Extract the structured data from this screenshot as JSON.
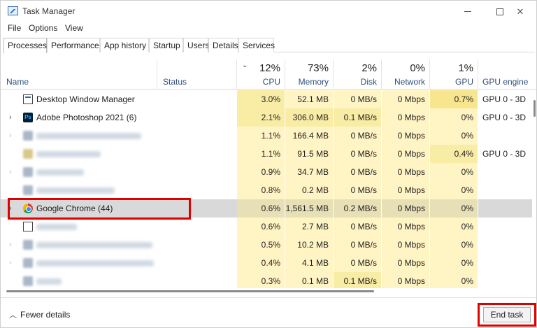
{
  "window": {
    "title": "Task Manager"
  },
  "menu": [
    "File",
    "Options",
    "View"
  ],
  "tabs": [
    "Processes",
    "Performance",
    "App history",
    "Startup",
    "Users",
    "Details",
    "Services"
  ],
  "columns": {
    "name": "Name",
    "status": "Status",
    "cpu": {
      "pct": "12%",
      "label": "CPU"
    },
    "memory": {
      "pct": "73%",
      "label": "Memory"
    },
    "disk": {
      "pct": "2%",
      "label": "Disk"
    },
    "network": {
      "pct": "0%",
      "label": "Network"
    },
    "gpu": {
      "pct": "1%",
      "label": "GPU"
    },
    "gpu_engine": "GPU engine"
  },
  "rows": [
    {
      "name": "Desktop Window Manager",
      "cpu": "3.0%",
      "memory": "52.1 MB",
      "disk": "0 MB/s",
      "network": "0 Mbps",
      "gpu": "0.7%",
      "gpu_engine": "GPU 0 - 3D"
    },
    {
      "name": "Adobe Photoshop 2021 (6)",
      "cpu": "2.1%",
      "memory": "306.0 MB",
      "disk": "0.1 MB/s",
      "network": "0 Mbps",
      "gpu": "0%",
      "gpu_engine": "GPU 0 - 3D"
    },
    {
      "name": "",
      "cpu": "1.1%",
      "memory": "166.4 MB",
      "disk": "0 MB/s",
      "network": "0 Mbps",
      "gpu": "0%",
      "gpu_engine": ""
    },
    {
      "name": "",
      "cpu": "1.1%",
      "memory": "91.5 MB",
      "disk": "0 MB/s",
      "network": "0 Mbps",
      "gpu": "0.4%",
      "gpu_engine": "GPU 0 - 3D"
    },
    {
      "name": "",
      "cpu": "0.9%",
      "memory": "34.7 MB",
      "disk": "0 MB/s",
      "network": "0 Mbps",
      "gpu": "0%",
      "gpu_engine": ""
    },
    {
      "name": "",
      "cpu": "0.8%",
      "memory": "0.2 MB",
      "disk": "0 MB/s",
      "network": "0 Mbps",
      "gpu": "0%",
      "gpu_engine": ""
    },
    {
      "name": "Google Chrome (44)",
      "cpu": "0.6%",
      "memory": "1,561.5 MB",
      "disk": "0.2 MB/s",
      "network": "0 Mbps",
      "gpu": "0%",
      "gpu_engine": ""
    },
    {
      "name": "",
      "cpu": "0.6%",
      "memory": "2.7 MB",
      "disk": "0 MB/s",
      "network": "0 Mbps",
      "gpu": "0%",
      "gpu_engine": ""
    },
    {
      "name": "",
      "cpu": "0.5%",
      "memory": "10.2 MB",
      "disk": "0 MB/s",
      "network": "0 Mbps",
      "gpu": "0%",
      "gpu_engine": ""
    },
    {
      "name": "",
      "cpu": "0.4%",
      "memory": "4.1 MB",
      "disk": "0 MB/s",
      "network": "0 Mbps",
      "gpu": "0%",
      "gpu_engine": ""
    },
    {
      "name": "",
      "cpu": "0.3%",
      "memory": "0.1 MB",
      "disk": "0.1 MB/s",
      "network": "0 Mbps",
      "gpu": "0%",
      "gpu_engine": ""
    }
  ],
  "footer": {
    "fewer_details": "Fewer details",
    "end_task": "End task"
  },
  "colors": {
    "heat_light": "#fff4c4",
    "heat_mid": "#f9eca5",
    "heat_strong": "#f7e68e",
    "selected_row": "#d9d9d9",
    "annotation_red": "#e00000"
  }
}
